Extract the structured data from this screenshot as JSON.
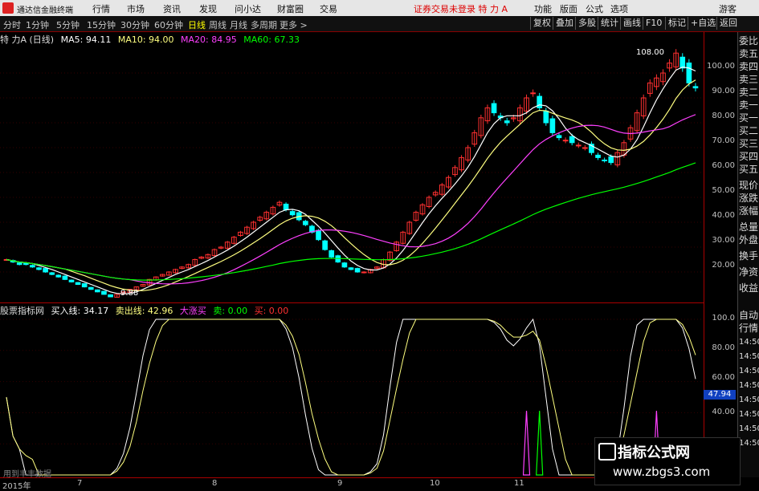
{
  "app": {
    "title": "通达信金融终端"
  },
  "menu": [
    "行情",
    "市场",
    "资讯",
    "发现",
    "问小达",
    "财富圈",
    "交易"
  ],
  "notice": "证券交易未登录  特 力 A",
  "menu_right": [
    "功能",
    "版面",
    "公式",
    "选项",
    "游客"
  ],
  "toolbar": {
    "periods": [
      "分时",
      "1分钟",
      "5分钟",
      "15分钟",
      "30分钟",
      "60分钟",
      "日线",
      "周线",
      "月线",
      "多周期",
      "更多 >"
    ],
    "active": "日线",
    "right_buttons": [
      "复权",
      "叠加",
      "多股",
      "统计",
      "画线",
      "F10",
      "标记",
      "+自选",
      "返回"
    ]
  },
  "main_legend": {
    "stock": "特 力A (日线)",
    "ma5": "MA5: 94.11",
    "ma10": "MA10: 94.00",
    "ma20": "MA20: 84.95",
    "ma60": "MA60: 67.33"
  },
  "sub_legend": {
    "name": "股票指标网",
    "buy_line": "买入线: 34.17",
    "sell_line": "卖出线: 42.96",
    "big_rise": "大涨买",
    "sell_label": "卖: 0.00",
    "buy_label": "买: 0.00",
    "zero": "0.00"
  },
  "annotations": {
    "high": "108.00",
    "low": "9.88"
  },
  "main_axis": [
    "100.00",
    "90.00",
    "80.00",
    "70.00",
    "60.00",
    "50.00",
    "40.00",
    "30.00",
    "20.00"
  ],
  "sub_axis": [
    "100.0",
    "80.00",
    "60.00",
    "40.00"
  ],
  "current_value": "47.94",
  "x_axis": [
    "2015年",
    "7",
    "8",
    "9",
    "10",
    "11"
  ],
  "sidebar": [
    "委比",
    "卖五",
    "卖四",
    "卖三",
    "卖二",
    "卖一",
    "买一",
    "买二",
    "买三",
    "买四",
    "买五",
    "现价",
    "涨跌",
    "涨幅",
    "总量",
    "外盘",
    "换手",
    "净资",
    "收益",
    "自动",
    "行情",
    "14:50",
    "14:50",
    "14:50",
    "14:50",
    "14:50",
    "14:50",
    "14:50",
    "14:50"
  ],
  "watermark": {
    "title": "指标公式网",
    "url": "www.zbgs3.com"
  },
  "user_label": "用到丰丰数据",
  "colors": {
    "up": "#ff3030",
    "down": "#00ffff",
    "ma5": "#ffffff",
    "ma10": "#ffff80",
    "ma20": "#ff40ff",
    "ma60": "#00ff00",
    "accent": "#aa0000"
  },
  "chart_data": {
    "type": "candlestick",
    "ylim": [
      10,
      110
    ],
    "closes": [
      25,
      24,
      23,
      23,
      22,
      21,
      20,
      19,
      18,
      17,
      16,
      15,
      14,
      13,
      12,
      11,
      10,
      11,
      12,
      13,
      14,
      15,
      17,
      18,
      19,
      20,
      21,
      22,
      23,
      25,
      26,
      27,
      29,
      30,
      32,
      34,
      36,
      38,
      40,
      42,
      44,
      46,
      48,
      45,
      43,
      41,
      39,
      36,
      33,
      29,
      26,
      24,
      22,
      21,
      20,
      20,
      21,
      22,
      25,
      28,
      32,
      36,
      40,
      44,
      47,
      50,
      52,
      55,
      58,
      62,
      66,
      70,
      76,
      82,
      86,
      84,
      82,
      80,
      82,
      86,
      90,
      92,
      86,
      80,
      76,
      74,
      73,
      72,
      71,
      70,
      68,
      66,
      65,
      64,
      68,
      72,
      78,
      84,
      90,
      96,
      98,
      100,
      104,
      108,
      102,
      96,
      94
    ]
  }
}
